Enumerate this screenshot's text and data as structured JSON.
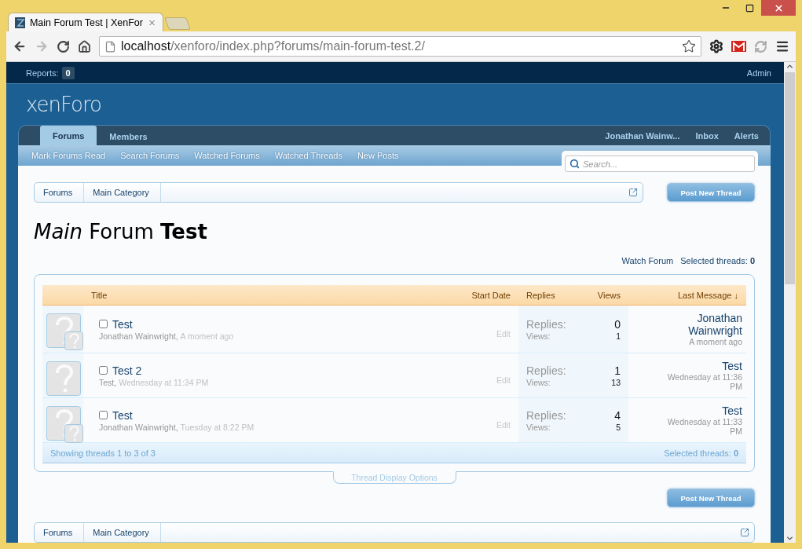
{
  "browser": {
    "tab": {
      "title": "Main Forum Test | XenFor",
      "selected": true
    },
    "url": {
      "host": "localhost",
      "path": "/xenforo/index.php?forums/main-forum-test.2/"
    }
  },
  "admin_bar": {
    "reports_label": "Reports:",
    "reports_count": "0",
    "admin_link": "Admin"
  },
  "header": {
    "logo": "xenForo"
  },
  "nav": {
    "tabs": [
      {
        "label": "Forums",
        "selected": true
      },
      {
        "label": "Members",
        "selected": false
      }
    ],
    "user_links": [
      "Jonathan Wainw...",
      "Inbox",
      "Alerts"
    ],
    "sub_links": [
      "Mark Forums Read",
      "Search Forums",
      "Watched Forums",
      "Watched Threads",
      "New Posts"
    ],
    "search": {
      "placeholder": "Search..."
    }
  },
  "breadcrumb": [
    "Forums",
    "Main Category"
  ],
  "post_button": "Post New Thread",
  "title": "*Main* Forum **Test**",
  "watch_forum": "Watch Forum",
  "selected_threads": {
    "label": "Selected threads:",
    "count": "0"
  },
  "table": {
    "columns": [
      "Title",
      "Start Date",
      "Replies",
      "Views",
      "Last Message ↓"
    ],
    "rows": [
      {
        "title": "Test",
        "checked": false,
        "second_avatar": true,
        "author": "Jonathan Wainwright,",
        "start_date": "A moment ago",
        "edit": "Edit",
        "replies_label": "Replies:",
        "replies": "0",
        "views_label": "Views:",
        "views": "1",
        "last_poster": "Jonathan Wainwright",
        "last_date": "A moment ago"
      },
      {
        "title": "Test 2",
        "checked": false,
        "second_avatar": false,
        "author": "Test,",
        "start_date": "Wednesday at 11:34 PM",
        "edit": "Edit",
        "replies_label": "Replies:",
        "replies": "1",
        "views_label": "Views:",
        "views": "13",
        "last_poster": "Test",
        "last_date": "Wednesday at 11:36 PM"
      },
      {
        "title": "Test",
        "checked": false,
        "second_avatar": true,
        "author": "Jonathan Wainwright,",
        "start_date": "Tuesday at 8:22 PM",
        "edit": "Edit",
        "replies_label": "Replies:",
        "replies": "4",
        "views_label": "Views:",
        "views": "5",
        "last_poster": "Test",
        "last_date": "Wednesday at 11:33 PM"
      }
    ],
    "footer": {
      "showing": "Showing threads 1 to 3 of 3",
      "selected_label": "Selected threads:",
      "selected_count": "0"
    }
  },
  "display_options": "Thread Display Options",
  "bottom_post_button": "Post New Thread",
  "bottom_breadcrumb": [
    "Forums",
    "Main Category"
  ]
}
